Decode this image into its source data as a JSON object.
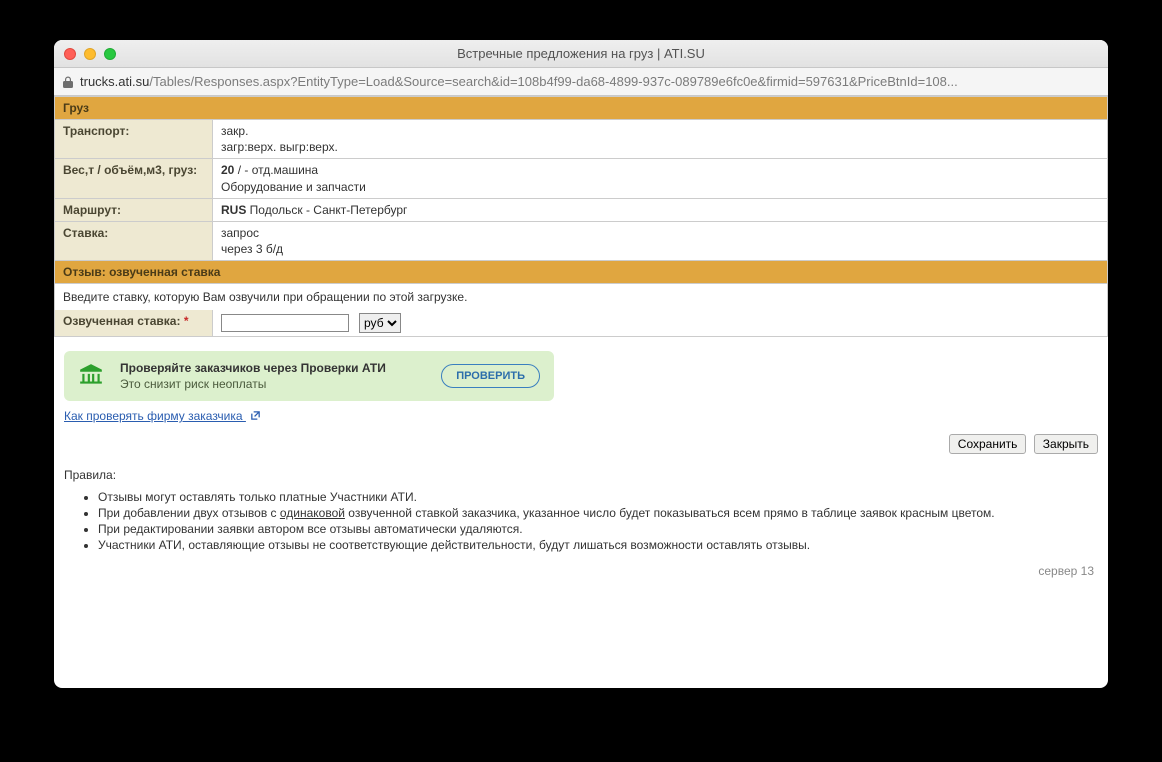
{
  "window": {
    "title": "Встречные предложения на груз | ATI.SU"
  },
  "url": {
    "host": "trucks.ati.su",
    "path": "/Tables/Responses.aspx?EntityType=Load&Source=search&id=108b4f99-da68-4899-937c-089789e6fc0e&firmid=597631&PriceBtnId=108..."
  },
  "sections": {
    "cargo": "Груз",
    "feedback": "Отзыв: озвученная ставка"
  },
  "info": {
    "transport_label": "Транспорт:",
    "transport_line1": "закр.",
    "transport_line2": "загр:верх. выгр:верх.",
    "weight_label": "Вес,т / объём,м3, груз:",
    "weight_num": "20",
    "weight_rest": " / - отд.машина",
    "weight_line2": "Оборудование и запчасти",
    "route_label": "Маршрут:",
    "route_country": "RUS",
    "route_rest": " Подольск - Санкт-Петербург",
    "rate_label": "Ставка:",
    "rate_line1": "запрос",
    "rate_line2": "через 3 б/д"
  },
  "instruction": "Введите ставку, которую Вам озвучили при обращении по этой загрузке.",
  "rate_input": {
    "label": "Озвученная ставка:",
    "required_mark": "*",
    "currency_options": [
      "руб"
    ],
    "currency_selected": "руб"
  },
  "banner": {
    "title": "Проверяйте заказчиков через Проверки АТИ",
    "subtitle": "Это снизит риск неоплаты",
    "button": "ПРОВЕРИТЬ"
  },
  "check_link": "Как проверять фирму заказчика ",
  "buttons": {
    "save": "Сохранить",
    "close": "Закрыть"
  },
  "rules": {
    "title": "Правила:",
    "r1": "Отзывы могут оставлять только платные Участники АТИ.",
    "r2a": "При добавлении двух отзывов с ",
    "r2u": "одинаковой",
    "r2b": " озвученной ставкой заказчика, указанное число будет показываться всем прямо в таблице заявок красным цветом.",
    "r3": "При редактировании заявки автором все отзывы автоматически удаляются.",
    "r4": "Участники АТИ, оставляющие отзывы не соответствующие действительности, будут лишаться возможности оставлять отзывы."
  },
  "footer": {
    "server": "сервер 13"
  }
}
